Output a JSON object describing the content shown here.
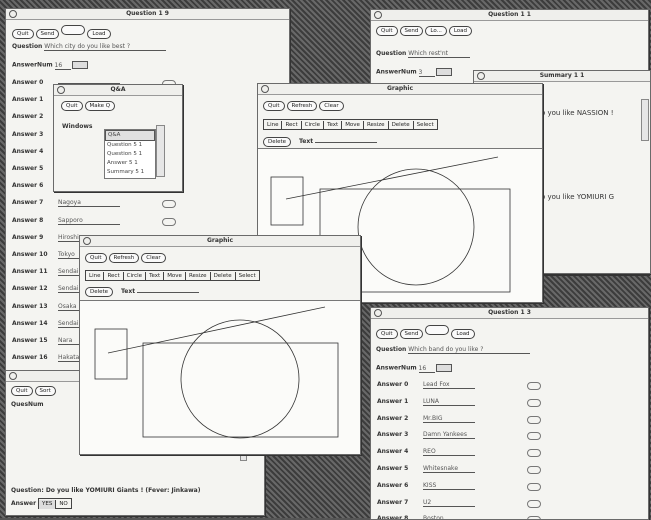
{
  "win_q19": {
    "title": "Question 1 9",
    "buttons": [
      "Quit",
      "Send",
      "",
      "Load"
    ],
    "question_label": "Question",
    "question_value": "Which city do you like best ?",
    "answernum_label": "AnswerNum",
    "answernum_value": "16",
    "answers": [
      {
        "label": "Answer  0",
        "value": ""
      },
      {
        "label": "Answer  1",
        "value": ""
      },
      {
        "label": "Answer  2",
        "value": ""
      },
      {
        "label": "Answer  3",
        "value": ""
      },
      {
        "label": "Answer  4",
        "value": ""
      },
      {
        "label": "Answer  5",
        "value": ""
      },
      {
        "label": "Answer  6",
        "value": ""
      },
      {
        "label": "Answer  7",
        "value": "Nagoya"
      },
      {
        "label": "Answer  8",
        "value": "Sapporo"
      },
      {
        "label": "Answer  9",
        "value": "Hiroshima"
      },
      {
        "label": "Answer 10",
        "value": "Tokyo"
      },
      {
        "label": "Answer 11",
        "value": "Sendai"
      },
      {
        "label": "Answer 12",
        "value": "Sendai"
      },
      {
        "label": "Answer 13",
        "value": "Osaka"
      },
      {
        "label": "Answer 14",
        "value": "Sendai"
      },
      {
        "label": "Answer 15",
        "value": "Nara"
      },
      {
        "label": "Answer 16",
        "value": "Hakata"
      }
    ]
  },
  "win_qa": {
    "title": "Q&A",
    "buttons": [
      "Quit",
      "Make Q"
    ],
    "windows_label": "Windows",
    "items": [
      "Q&A",
      "Question 5 1",
      "Question 5 1",
      "Answer 5 1",
      "Summary 5 1"
    ]
  },
  "win_q11": {
    "title": "Question 1 1",
    "buttons": [
      "Quit",
      "Send",
      "Lo...",
      "Load"
    ],
    "question_label": "Question",
    "question_value": "Which rest'nt",
    "answernum_label": "AnswerNum",
    "answernum_value": "3"
  },
  "win_summary": {
    "title": "Summary 1 1",
    "line1": "o you like NASSION !",
    "line2": "o you like YOMIURI G"
  },
  "win_graphic_back": {
    "title": "Graphic",
    "buttons": [
      "Quit",
      "Refresh",
      "Clear"
    ],
    "tools": [
      "Line",
      "Rect",
      "Circle",
      "Text",
      "Move",
      "Resize",
      "Delete",
      "Select"
    ],
    "delete_label": "Delete",
    "text_label": "Text"
  },
  "win_graphic_front": {
    "title": "Graphic",
    "buttons": [
      "Quit",
      "Refresh",
      "Clear"
    ],
    "tools": [
      "Line",
      "Rect",
      "Circle",
      "Text",
      "Move",
      "Resize",
      "Delete",
      "Select"
    ],
    "delete_label": "Delete",
    "text_label": "Text"
  },
  "win_answer": {
    "buttons": [
      "Quit",
      "Sort"
    ],
    "question_label": "QuesNum",
    "question_text": "Question: Do you like YOMIURI Giants ! (Fever: Jinkawa)",
    "answer_label": "Answer",
    "answer_options": [
      "YES",
      "NO"
    ]
  },
  "win_q13": {
    "title": "Question 1 3",
    "buttons": [
      "Quit",
      "Send",
      "",
      "Load"
    ],
    "question_label": "Question",
    "question_value": "Which band do you like ?",
    "answernum_label": "AnswerNum",
    "answernum_value": "16",
    "answers": [
      {
        "label": "Answer  0",
        "value": "Lead Fox"
      },
      {
        "label": "Answer  1",
        "value": "LUNA"
      },
      {
        "label": "Answer  2",
        "value": "Mr.BIG"
      },
      {
        "label": "Answer  3",
        "value": "Damn Yankees"
      },
      {
        "label": "Answer  4",
        "value": "REO"
      },
      {
        "label": "Answer  5",
        "value": "Whitesnake"
      },
      {
        "label": "Answer  6",
        "value": "KISS"
      },
      {
        "label": "Answer  7",
        "value": "U2"
      },
      {
        "label": "Answer  8",
        "value": "Boston"
      }
    ]
  }
}
